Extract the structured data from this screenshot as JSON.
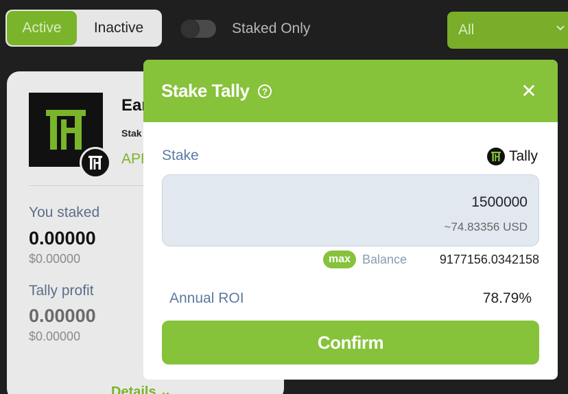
{
  "filters": {
    "active_label": "Active",
    "inactive_label": "Inactive",
    "staked_only_label": "Staked Only",
    "select_value": "All"
  },
  "card": {
    "title": "Ear",
    "subtitle": "Stak",
    "apr_label": "APF",
    "you_staked_label": "You staked",
    "you_staked_value": "0.00000",
    "you_staked_usd": "$0.00000",
    "profit_label": "Tally profit",
    "profit_value": "0.00000",
    "profit_usd": "$0.00000",
    "details_label": "Details"
  },
  "modal": {
    "title": "Stake Tally",
    "stake_label": "Stake",
    "token_name": "Tally",
    "amount_value": "1500000",
    "amount_usd": "~74.83356 USD",
    "max_label": "max",
    "balance_label": "Balance",
    "balance_value": "9177156.0342158",
    "roi_label": "Annual ROI",
    "roi_value": "78.79%",
    "confirm_label": "Confirm"
  },
  "icons": {
    "help": "help-circle-icon",
    "close": "close-icon",
    "select_chevron": "chevron-down-icon",
    "token": "tally-token-icon"
  },
  "colors": {
    "accent": "#86c23a",
    "accent_dark": "#79ad2a",
    "background": "#1f1f1f"
  }
}
